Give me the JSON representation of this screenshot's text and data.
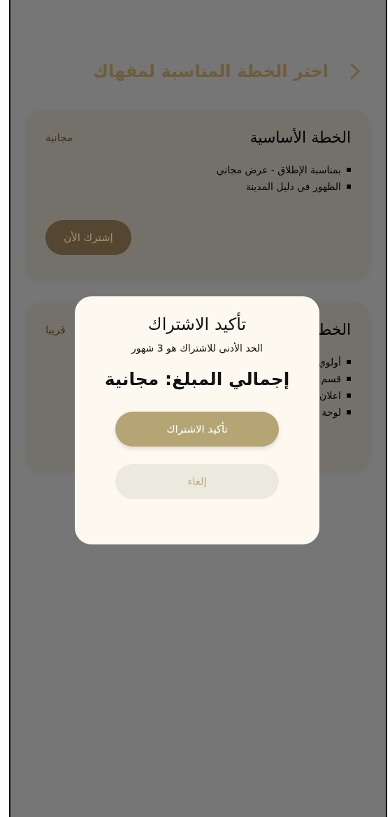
{
  "header": {
    "title": "اختر الخطة المناسبة لمقهاك"
  },
  "plans": [
    {
      "title": "الخطة الأساسية",
      "badge": "مجانية",
      "features": [
        "بمناسبة الإطلاق - عرض مجاني",
        "الظهور في دليل المدينة"
      ],
      "button": "إشترك الأن"
    },
    {
      "title": "الخط",
      "badge": "قريبا",
      "features": [
        "أولوي",
        "قسم",
        "اعلان",
        "لوحة"
      ]
    }
  ],
  "dialog": {
    "title": "تأكيد الاشتراك",
    "note": "الحد الأدنى للاشتراك هو 3 شهور",
    "total": "إجمالي المبلغ: مجانية",
    "buttons": [
      {
        "label": "تأكيد الاشتراك",
        "kind": "primary"
      },
      {
        "label": "إلغاء",
        "kind": "secondary"
      }
    ]
  }
}
